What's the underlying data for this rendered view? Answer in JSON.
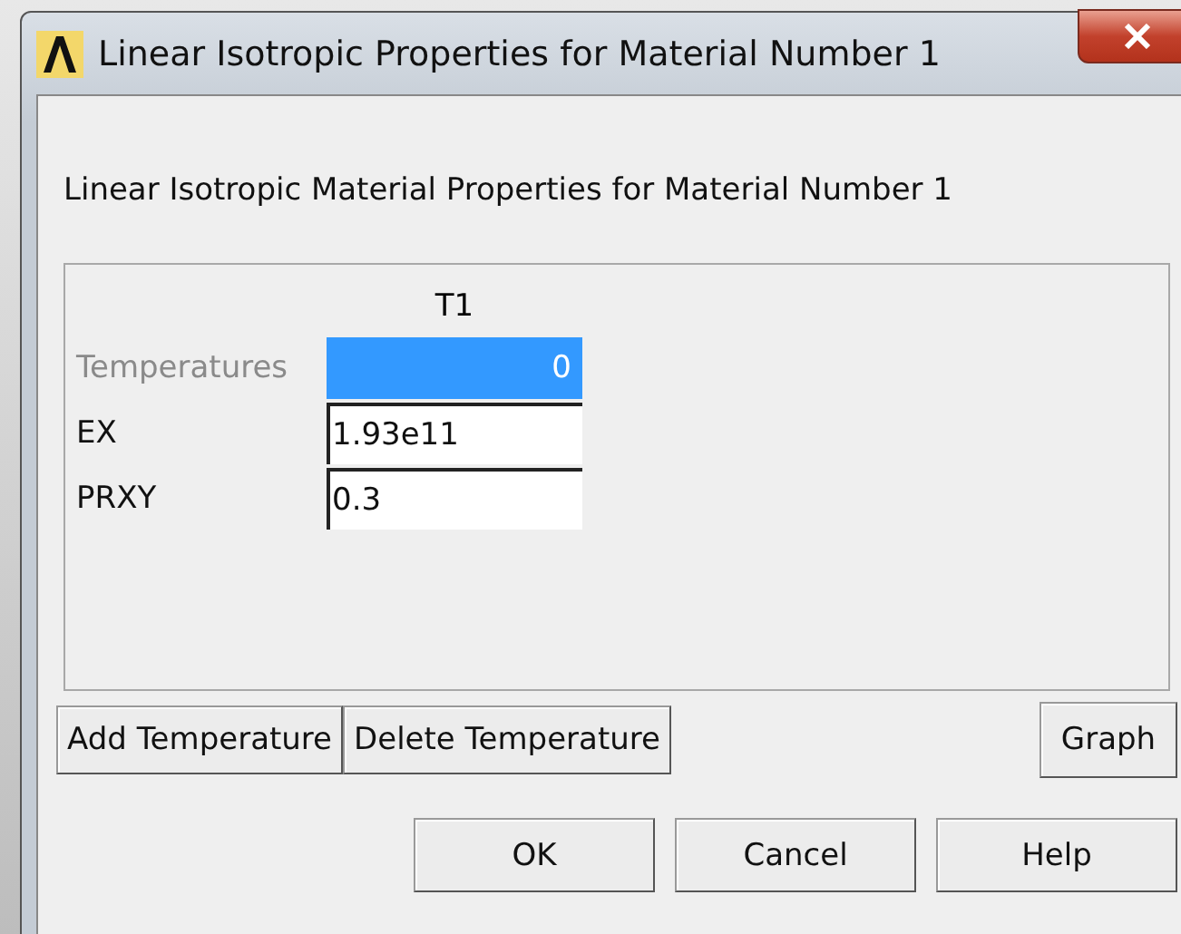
{
  "window": {
    "title": "Linear Isotropic Properties for Material Number 1"
  },
  "heading": "Linear Isotropic Material Properties for Material Number 1",
  "table": {
    "columns": [
      "T1"
    ],
    "rows": [
      {
        "label": "Temperatures",
        "value": "0",
        "disabled": true,
        "selected": true
      },
      {
        "label": "EX",
        "value": "1.93e11",
        "disabled": false,
        "selected": false
      },
      {
        "label": "PRXY",
        "value": "0.3",
        "disabled": false,
        "selected": false
      }
    ]
  },
  "table_buttons": [
    "Add Temperature",
    "Delete Temperature"
  ],
  "graph_button": "Graph",
  "dialog_buttons": [
    "OK",
    "Cancel",
    "Help"
  ]
}
